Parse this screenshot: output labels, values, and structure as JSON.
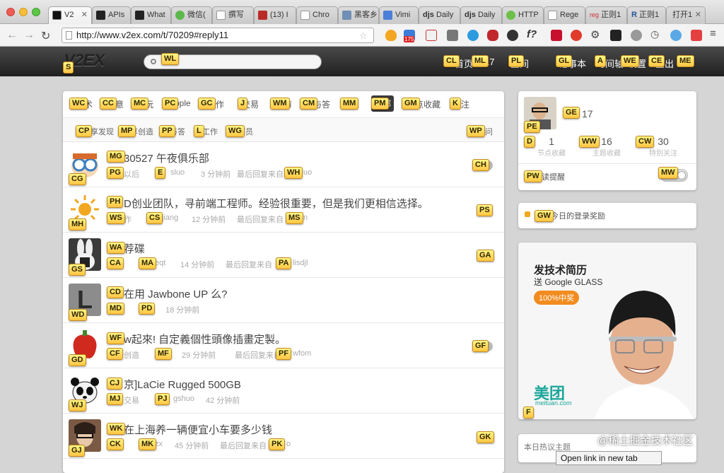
{
  "browser": {
    "tabs": [
      "V2",
      "APIs",
      "What",
      "微信(",
      "撰写",
      "(13) I",
      "Chro",
      "黑客乡",
      "Vimi",
      "Daily",
      "Daily",
      "HTTP",
      "Rege",
      "正则1",
      "正则1",
      "打开1"
    ],
    "tab_icon_texts": [
      "djs",
      "djs",
      "reg",
      "R"
    ],
    "url": "http://www.v2ex.com/t/70209#reply11",
    "ext_badge": "175"
  },
  "site": {
    "logo": "V2EX",
    "nav": [
      {
        "hint": "CL",
        "text": "首页"
      },
      {
        "hint": "ML",
        "text": "17"
      },
      {
        "hint": "PL",
        "text": "空间"
      },
      {
        "hint": "GL",
        "text": "记事本"
      },
      {
        "hint": "A",
        "text": "时间轴"
      },
      {
        "hint": "WE",
        "text": "设置"
      },
      {
        "hint": "CE",
        "text": "登出"
      },
      {
        "hint": "ME",
        "text": ""
      }
    ]
  },
  "hints": {
    "logo": "S",
    "search": "WL"
  },
  "node_tabs": [
    {
      "hint": "WC",
      "text": "技术"
    },
    {
      "hint": "CC",
      "text": "创意"
    },
    {
      "hint": "MC",
      "text": "好玩"
    },
    {
      "hint": "PC",
      "text": "Apple"
    },
    {
      "hint": "GC",
      "text": "工作"
    },
    {
      "hint": "J",
      "text": "交易"
    },
    {
      "hint": "WM",
      "text": "城市"
    },
    {
      "hint": "CM",
      "text": "问与答"
    },
    {
      "hint": "MM",
      "text": "最热"
    },
    {
      "hint": "PM",
      "text": "全部"
    },
    {
      "hint": "GM",
      "text": "节点收藏"
    },
    {
      "hint": "K",
      "text": "关注"
    }
  ],
  "sub_tabs": [
    {
      "hint": "CP",
      "text": "分享发现"
    },
    {
      "hint": "MP",
      "text": "分享创造"
    },
    {
      "hint": "PP",
      "text": "问与答"
    },
    {
      "hint": "L",
      "text": "酷工作"
    },
    {
      "hint": "WG",
      "text": "程序员"
    }
  ],
  "sub_right": {
    "hint": "WP",
    "text": "提问"
  },
  "topics": [
    {
      "h_ava": "CG",
      "h_title": "MG",
      "title": "30527 午夜俱乐部",
      "h_node": "PG",
      "node": "以后",
      "h_user": "E",
      "user": "sluo",
      "time": "3 分钟前",
      "last": "最后回复来自",
      "h_last": "WH",
      "last_user": "uo",
      "h_cnt": "CH"
    },
    {
      "h_ava": "MH",
      "h_title": "PH",
      "title": "D创业团队，寻前端工程师。经验很重要，但是我们更相信选择。",
      "h_node": "WS",
      "node": "作",
      "h_user": "CS",
      "user": "jiang",
      "time": "12 分钟前",
      "last": "最后回复来自",
      "h_last": "MS",
      "last_user": "n",
      "h_cnt": "PS"
    },
    {
      "h_ava": "GS",
      "h_title": "WA",
      "title": "荐碟",
      "h_node": "CA",
      "node": "",
      "h_user": "MA",
      "user": "eqt",
      "time": "14 分钟前",
      "last": "最后回复来自",
      "h_last": "PA",
      "last_user": "lisdjl",
      "h_cnt": "GA"
    },
    {
      "h_ava": "WD",
      "h_title": "CD",
      "title": "在用 Jawbone UP 么?",
      "h_node": "MD",
      "node": "",
      "h_user": "PD",
      "user": "",
      "time": "18 分钟前",
      "last": "",
      "h_last": "",
      "last_user": "",
      "h_cnt": ""
    },
    {
      "h_ava": "GD",
      "h_title": "WF",
      "title": "w起來! 自定義個性頭像插畫定製。",
      "h_node": "CF",
      "node": "创造",
      "h_user": "MF",
      "user": "",
      "time": "29 分钟前",
      "last": "最后回复来自",
      "h_last": "PF",
      "last_user": "wfom",
      "h_cnt": "GF"
    },
    {
      "h_ava": "WJ",
      "h_title": "CJ",
      "title": "京]LaCie Rugged 500GB",
      "h_node": "MJ",
      "node": "交易",
      "h_user": "PJ",
      "user": "gshuo",
      "time": "42 分钟前",
      "last": "",
      "h_last": "",
      "last_user": "",
      "h_cnt": ""
    },
    {
      "h_ava": "GJ",
      "h_title": "WK",
      "title": "在上海养一辆便宜小车要多少钱",
      "h_node": "CK",
      "node": "",
      "h_user": "MK",
      "user": "zx",
      "time": "45 分钟前",
      "last": "最后回复来自",
      "h_last": "PK",
      "last_user": "o",
      "h_cnt": "GK"
    }
  ],
  "profile": {
    "h_avatar": "PE",
    "h_name": "GE",
    "name": "17",
    "stats": [
      {
        "hint": "D",
        "num": "1",
        "label": "节点收藏"
      },
      {
        "hint": "WW",
        "num": "16",
        "label": "主题收藏"
      },
      {
        "hint": "CW",
        "num": "30",
        "label": "特别关注"
      }
    ],
    "h_notice": "PW",
    "notice": "未读提醒",
    "h_toggle": "MW"
  },
  "daily": {
    "hint": "GW",
    "text": "领取今日的登录奖励"
  },
  "ad": {
    "line1": "发技术简历",
    "line2": "送 Google GLASS",
    "badge": "100%中奖",
    "brand": "美团",
    "brand_sub": "meituan.com",
    "hint": "F"
  },
  "hot_title": "本日热议主题",
  "context_menu": "Open link in new tab",
  "watermark": "@稀土掘金技术社区"
}
